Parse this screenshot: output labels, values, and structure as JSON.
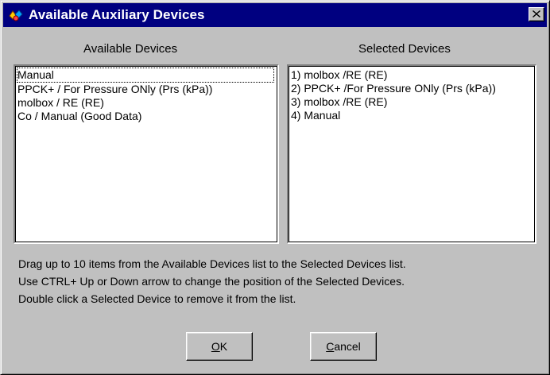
{
  "window": {
    "title": "Available Auxiliary Devices",
    "icon": "devices-app-icon",
    "close_icon": "close-icon"
  },
  "available": {
    "heading": "Available Devices",
    "items": [
      "Manual",
      "PPCK+  / For Pressure ONly  (Prs (kPa))",
      "molbox  / RE  (RE)",
      "Co  / Manual  (Good Data)"
    ],
    "focused_index": 0
  },
  "selected": {
    "heading": "Selected Devices",
    "items": [
      "1) molbox /RE (RE)",
      "2) PPCK+ /For Pressure ONly (Prs (kPa))",
      "3) molbox /RE (RE)",
      "4) Manual"
    ]
  },
  "help": {
    "line1": "Drag up to 10 items  from the Available Devices list to the Selected Devices list.",
    "line2": "Use CTRL+ Up or Down arrow to change the position of the Selected Devices.",
    "line3": "Double click a Selected Device to remove it from the list."
  },
  "buttons": {
    "ok_mnemonic": "O",
    "ok_rest": "K",
    "cancel_mnemonic": "C",
    "cancel_rest": "ancel"
  },
  "colors": {
    "titlebar": "#000080",
    "face": "#c0c0c0"
  }
}
